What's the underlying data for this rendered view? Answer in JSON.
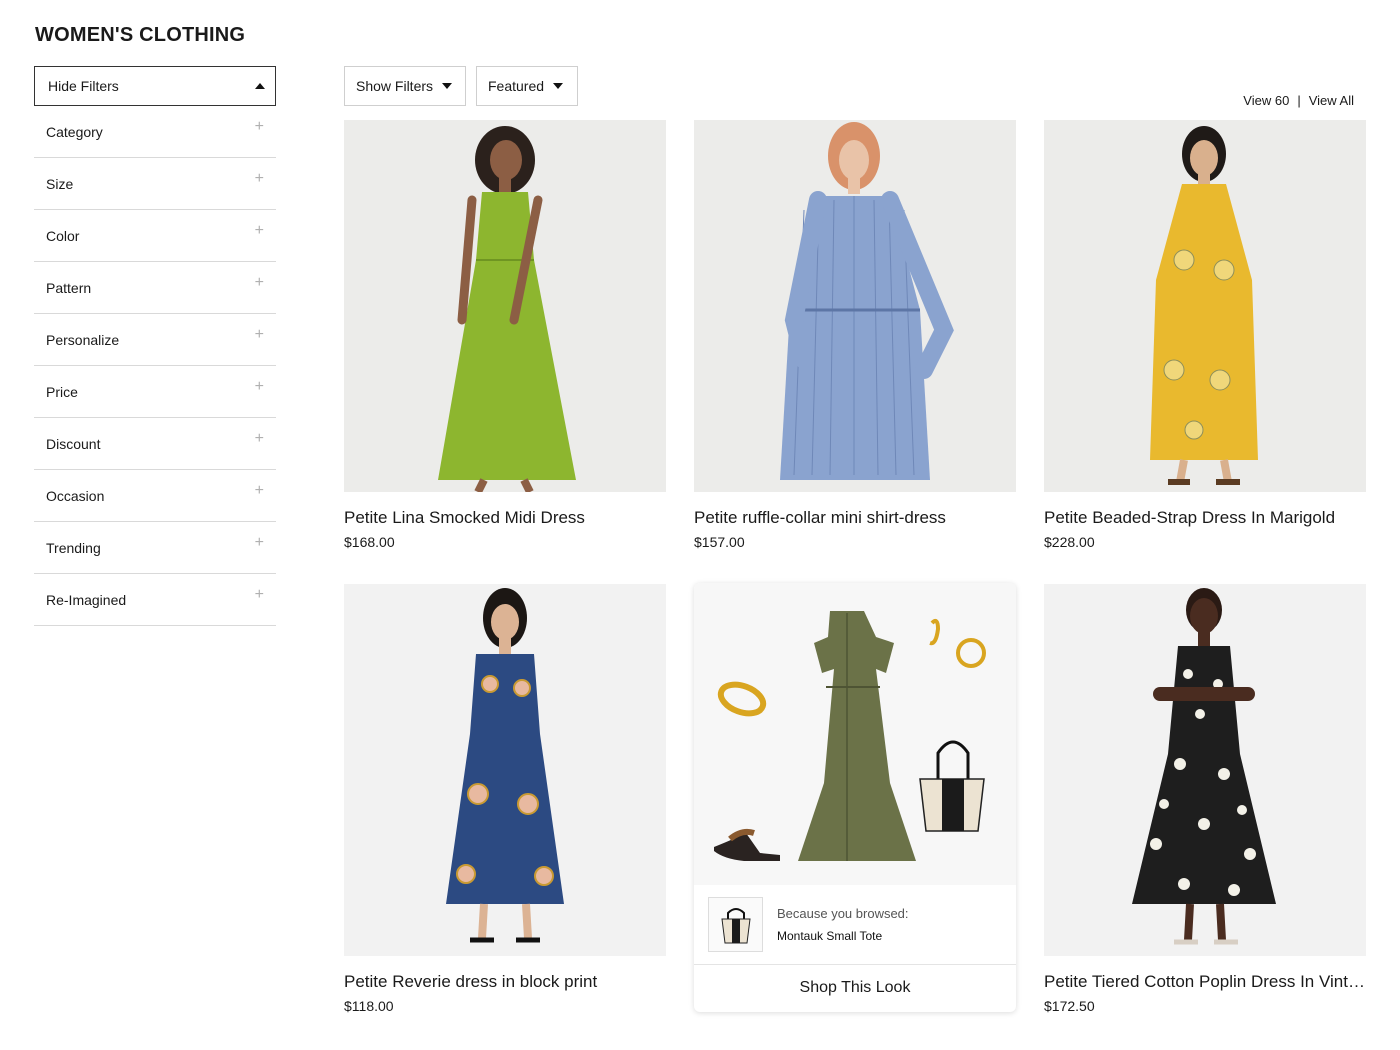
{
  "page": {
    "title": "WOMEN'S CLOTHING"
  },
  "sidebar": {
    "hide_filters_label": "Hide Filters",
    "filters": [
      "Category",
      "Size",
      "Color",
      "Pattern",
      "Personalize",
      "Price",
      "Discount",
      "Occasion",
      "Trending",
      "Re-Imagined"
    ]
  },
  "toolbar": {
    "show_filters_label": "Show Filters",
    "sort_label": "Featured",
    "view_60_label": "View 60",
    "separator": "|",
    "view_all_label": "View All"
  },
  "products": [
    {
      "name": "Petite Lina Smocked Midi Dress",
      "price": "$168.00"
    },
    {
      "name": "Petite ruffle-collar mini shirt-dress",
      "price": "$157.00"
    },
    {
      "name": "Petite Beaded-Strap Dress In Marigold",
      "price": "$228.00"
    },
    {
      "name": "Petite Reverie dress in block print",
      "price": "$118.00"
    },
    {
      "name": "Petite Tiered Cotton Poplin Dress In Vintage Daisy",
      "price": "$172.50"
    }
  ],
  "promo": {
    "because_label": "Because you browsed:",
    "browsed_product": "Montauk Small Tote",
    "cta_label": "Shop This Look"
  },
  "colors": {
    "green_dress": "#8db62f",
    "blue_shirt": "#8aa3cf",
    "yellow_dress": "#e9b92e",
    "navy_dress": "#2c4a82",
    "olive_dress": "#6b7248",
    "black_dress": "#1e1e1e",
    "gold": "#d9a520"
  }
}
